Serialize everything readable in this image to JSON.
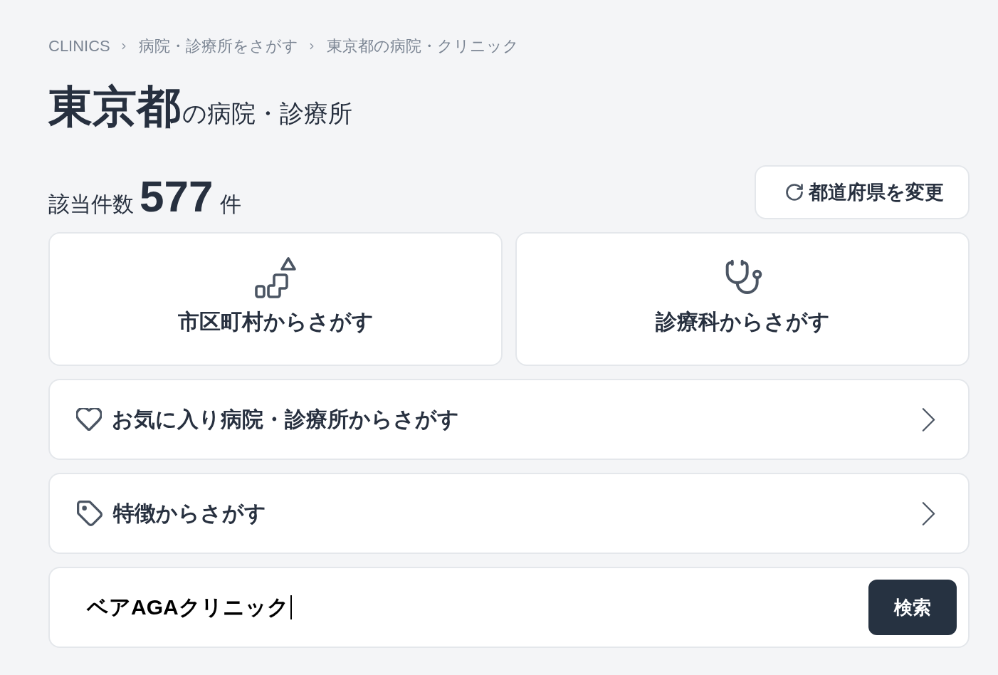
{
  "breadcrumb": [
    {
      "label": "CLINICS"
    },
    {
      "label": "病院・診療所をさがす"
    },
    {
      "label": "東京都の病院・クリニック"
    }
  ],
  "heading": {
    "prefecture": "東京都",
    "suffix": "の病院・診療所"
  },
  "result_count": {
    "label": "該当件数",
    "count": "577",
    "unit": "件"
  },
  "change_prefecture_button": {
    "label": "都道府県を変更"
  },
  "search_cards": [
    {
      "kind": "area",
      "label": "市区町村からさがす"
    },
    {
      "kind": "department",
      "label": "診療科からさがす"
    }
  ],
  "search_links": [
    {
      "kind": "favorite",
      "label": "お気に入り病院・診療所からさがす"
    },
    {
      "kind": "feature",
      "label": "特徴からさがす"
    }
  ],
  "search": {
    "value": "ベアAGAクリニック",
    "focused": true,
    "button": "検索"
  }
}
